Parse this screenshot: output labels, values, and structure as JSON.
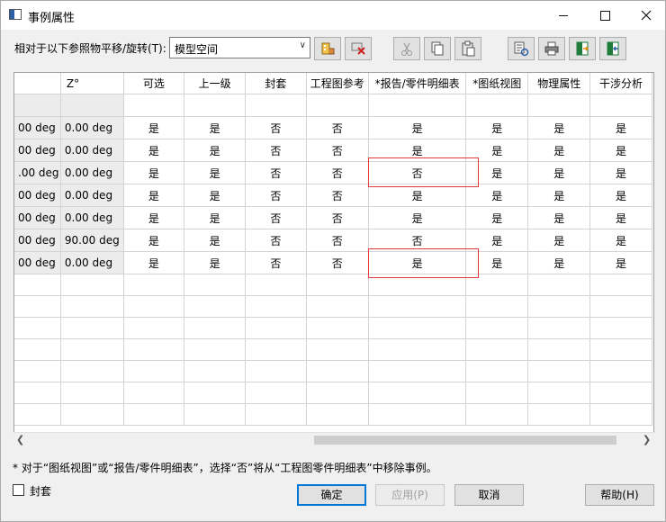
{
  "window": {
    "title": "事例属性"
  },
  "toolbar": {
    "relative_label": "相对于以下参照物平移/旋转(T):",
    "combo_value": "模型空间",
    "buttons": [
      {
        "name": "reference-pick-button",
        "icon": "building-pick-icon"
      },
      {
        "name": "reference-clear-button",
        "icon": "clear-x-icon"
      },
      {
        "name": "cut-button",
        "icon": "scissors-icon"
      },
      {
        "name": "copy-button",
        "icon": "copy-icon"
      },
      {
        "name": "paste-button",
        "icon": "paste-icon"
      },
      {
        "name": "reset-button",
        "icon": "reset-icon"
      },
      {
        "name": "print-button",
        "icon": "printer-icon"
      },
      {
        "name": "export-button",
        "icon": "export-excel-icon"
      },
      {
        "name": "import-button",
        "icon": "import-excel-icon"
      }
    ]
  },
  "grid": {
    "columns": [
      "",
      "Z°",
      "可选",
      "上一级",
      "封套",
      "工程图参考",
      "*报告/零件明细表",
      "*图纸视图",
      "物理属性",
      "干涉分析"
    ],
    "rows": [
      [
        "00 deg",
        "0.00 deg",
        "是",
        "是",
        "否",
        "否",
        "是",
        "是",
        "是",
        "是"
      ],
      [
        "00 deg",
        "0.00 deg",
        "是",
        "是",
        "否",
        "否",
        "是",
        "是",
        "是",
        "是"
      ],
      [
        ".00 deg",
        "0.00 deg",
        "是",
        "是",
        "否",
        "否",
        "否",
        "是",
        "是",
        "是"
      ],
      [
        "00 deg",
        "0.00 deg",
        "是",
        "是",
        "否",
        "否",
        "是",
        "是",
        "是",
        "是"
      ],
      [
        "00 deg",
        "0.00 deg",
        "是",
        "是",
        "否",
        "否",
        "是",
        "是",
        "是",
        "是"
      ],
      [
        "00 deg",
        "90.00 deg",
        "是",
        "是",
        "否",
        "否",
        "否",
        "是",
        "是",
        "是"
      ],
      [
        "00 deg",
        "0.00 deg",
        "是",
        "是",
        "否",
        "否",
        "是",
        "是",
        "是",
        "是"
      ]
    ],
    "blank_rows": 7
  },
  "footnote": "* 对于“图纸视图”或“报告/零件明细表”，选择“否”将从“工程图零件明细表”中移除事例。",
  "envelope_checkbox": {
    "label": "封套",
    "checked": false
  },
  "buttons": {
    "ok": "确定",
    "apply": "应用(P)",
    "cancel": "取消",
    "help": "帮助(H)"
  },
  "colors": {
    "highlight": "#e03a3a",
    "accent": "#0078d7"
  }
}
